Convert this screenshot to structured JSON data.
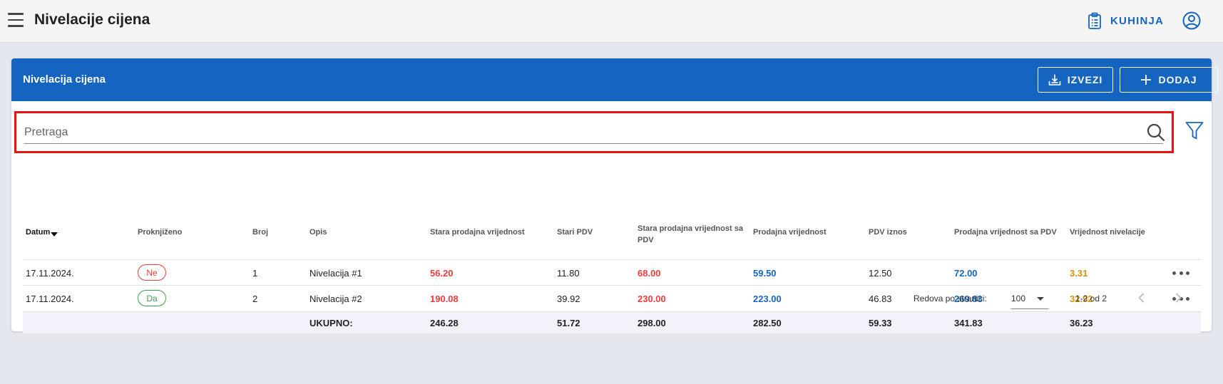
{
  "appbar": {
    "title": "Nivelacije cijena",
    "kitchen_label": "KUHINJA"
  },
  "card": {
    "title": "Nivelacija cijena",
    "export_label": "IZVEZI",
    "add_label": "DODAJ"
  },
  "search": {
    "placeholder": "Pretraga",
    "value": ""
  },
  "table": {
    "columns": {
      "datum": "Datum",
      "proknjizeno": "Proknjiženo",
      "broj": "Broj",
      "opis": "Opis",
      "stara_prodajna": "Stara prodajna vrijednost",
      "stari_pdv": "Stari PDV",
      "stara_sa_pdv": "Stara prodajna vrijednost sa PDV",
      "prodajna": "Prodajna vrijednost",
      "pdv_iznos": "PDV iznos",
      "prodajna_sa_pdv": "Prodajna vrijednost sa PDV",
      "vrijednost_nivelacije": "Vrijednost nivelacije"
    },
    "sort_column": "Datum",
    "rows": [
      {
        "datum": "17.11.2024.",
        "proknjizeno": "Ne",
        "broj": "1",
        "opis": "Nivelacija #1",
        "stara_prodajna": "56.20",
        "stari_pdv": "11.80",
        "stara_sa_pdv": "68.00",
        "prodajna": "59.50",
        "pdv_iznos": "12.50",
        "prodajna_sa_pdv": "72.00",
        "vrijednost_nivelacije": "3.31"
      },
      {
        "datum": "17.11.2024.",
        "proknjizeno": "Da",
        "broj": "2",
        "opis": "Nivelacija #2",
        "stara_prodajna": "190.08",
        "stari_pdv": "39.92",
        "stara_sa_pdv": "230.00",
        "prodajna": "223.00",
        "pdv_iznos": "46.83",
        "prodajna_sa_pdv": "269.83",
        "vrijednost_nivelacije": "32.92"
      }
    ],
    "totals": {
      "label": "UKUPNO:",
      "stara_prodajna": "246.28",
      "stari_pdv": "51.72",
      "stara_sa_pdv": "298.00",
      "prodajna": "282.50",
      "pdv_iznos": "59.33",
      "prodajna_sa_pdv": "341.83",
      "vrijednost_nivelacije": "36.23"
    }
  },
  "pagination": {
    "rows_per_page_label": "Redova po stranici:",
    "rows_per_page": "100",
    "range": "1-2 od 2"
  },
  "colors": {
    "primary": "#1565c0",
    "negative": "#ef3b3b",
    "positive": "#3aa34a",
    "accent": "#d4930a",
    "highlight_frame": "#ee1111"
  }
}
